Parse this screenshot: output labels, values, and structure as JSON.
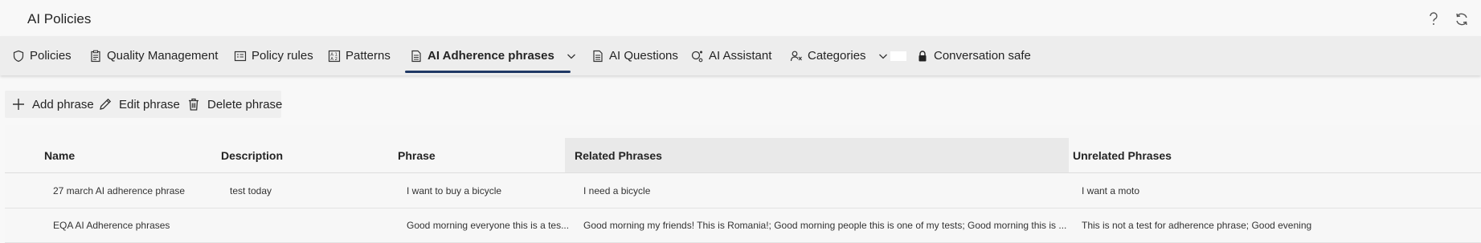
{
  "app": {
    "title": "AI Policies",
    "help_icon": "question-mark-icon",
    "refresh_icon": "refresh-icon"
  },
  "nav": {
    "tabs": [
      {
        "label": "Policies",
        "icon": "shield-icon"
      },
      {
        "label": "Quality Management",
        "icon": "clipboard-icon"
      },
      {
        "label": "Policy rules",
        "icon": "list-rules-icon"
      },
      {
        "label": "Patterns",
        "icon": "pattern-icon"
      },
      {
        "label": "AI Adherence phrases",
        "icon": "document-icon",
        "active": true,
        "has_dropdown": true
      },
      {
        "label": "AI Questions",
        "icon": "document-icon"
      },
      {
        "label": "AI Assistant",
        "icon": "assistant-icon"
      },
      {
        "label": "Categories",
        "icon": "people-icon",
        "has_dropdown": true
      },
      {
        "label": "Conversation safe",
        "icon": "lock-icon"
      }
    ]
  },
  "toolbar": {
    "add_label": "Add phrase",
    "edit_label": "Edit phrase",
    "delete_label": "Delete phrase"
  },
  "table": {
    "columns": [
      "Name",
      "Description",
      "Phrase",
      "Related Phrases",
      "Unrelated Phrases"
    ],
    "rows": [
      [
        "27 march AI adherence phrase",
        "test today",
        "I want to buy a bicycle",
        "I need a bicycle",
        "I want a moto"
      ],
      [
        "EQA AI Adherence phrases",
        "",
        "Good morning everyone this is a tes...",
        "Good morning my friends! This is Romania!; Good morning people this is one of my tests; Good morning this is ...",
        "This is not a test for adherence phrase; Good evening"
      ]
    ]
  },
  "colors": {
    "accent": "#1f3864",
    "nav_bg": "#ededed",
    "page_bg": "#f8f8f8"
  }
}
